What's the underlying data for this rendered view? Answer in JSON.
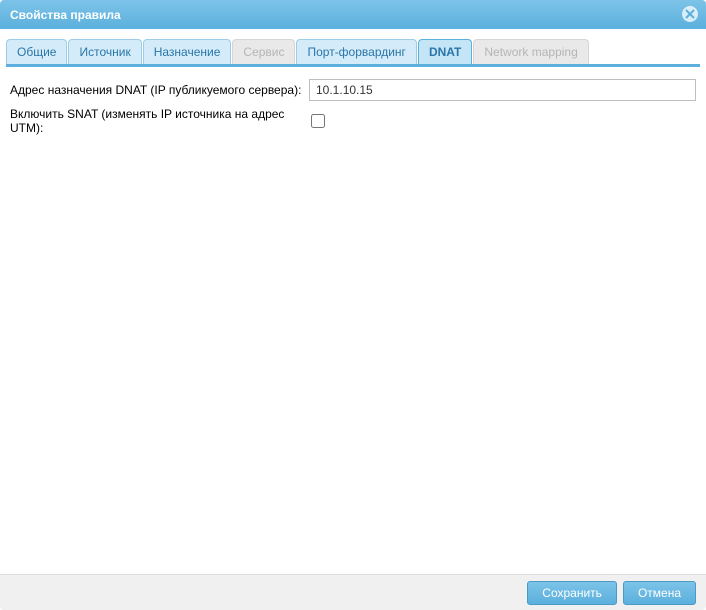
{
  "window": {
    "title": "Свойства правила"
  },
  "tabs": [
    {
      "label": "Общие",
      "state": "normal"
    },
    {
      "label": "Источник",
      "state": "normal"
    },
    {
      "label": "Назначение",
      "state": "normal"
    },
    {
      "label": "Сервис",
      "state": "disabled"
    },
    {
      "label": "Порт-форвардинг",
      "state": "normal"
    },
    {
      "label": "DNAT",
      "state": "active"
    },
    {
      "label": "Network mapping",
      "state": "disabled"
    }
  ],
  "form": {
    "dnat_address_label": "Адрес назначения DNAT (IP публикуемого сервера):",
    "dnat_address_value": "10.1.10.15",
    "enable_snat_label": "Включить SNAT (изменять IP источника на адрес UTM):",
    "enable_snat_checked": false
  },
  "buttons": {
    "save": "Сохранить",
    "cancel": "Отмена"
  }
}
